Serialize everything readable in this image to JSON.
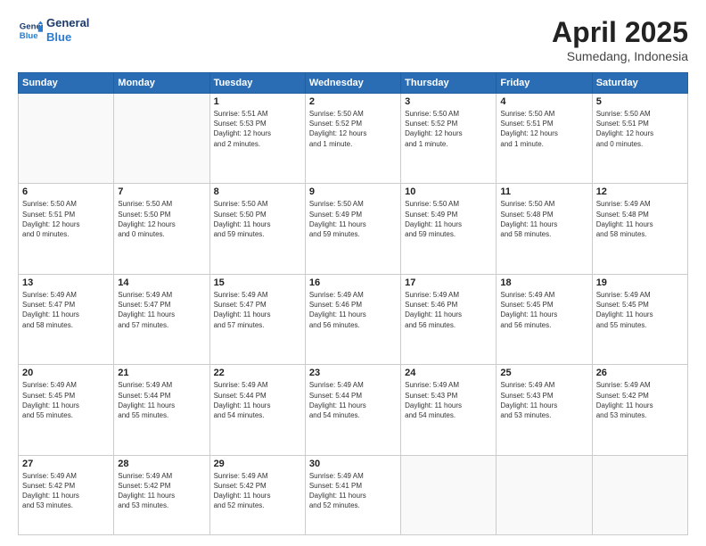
{
  "header": {
    "logo_line1": "General",
    "logo_line2": "Blue",
    "title": "April 2025",
    "subtitle": "Sumedang, Indonesia"
  },
  "weekdays": [
    "Sunday",
    "Monday",
    "Tuesday",
    "Wednesday",
    "Thursday",
    "Friday",
    "Saturday"
  ],
  "weeks": [
    [
      {
        "day": "",
        "info": ""
      },
      {
        "day": "",
        "info": ""
      },
      {
        "day": "1",
        "info": "Sunrise: 5:51 AM\nSunset: 5:53 PM\nDaylight: 12 hours\nand 2 minutes."
      },
      {
        "day": "2",
        "info": "Sunrise: 5:50 AM\nSunset: 5:52 PM\nDaylight: 12 hours\nand 1 minute."
      },
      {
        "day": "3",
        "info": "Sunrise: 5:50 AM\nSunset: 5:52 PM\nDaylight: 12 hours\nand 1 minute."
      },
      {
        "day": "4",
        "info": "Sunrise: 5:50 AM\nSunset: 5:51 PM\nDaylight: 12 hours\nand 1 minute."
      },
      {
        "day": "5",
        "info": "Sunrise: 5:50 AM\nSunset: 5:51 PM\nDaylight: 12 hours\nand 0 minutes."
      }
    ],
    [
      {
        "day": "6",
        "info": "Sunrise: 5:50 AM\nSunset: 5:51 PM\nDaylight: 12 hours\nand 0 minutes."
      },
      {
        "day": "7",
        "info": "Sunrise: 5:50 AM\nSunset: 5:50 PM\nDaylight: 12 hours\nand 0 minutes."
      },
      {
        "day": "8",
        "info": "Sunrise: 5:50 AM\nSunset: 5:50 PM\nDaylight: 11 hours\nand 59 minutes."
      },
      {
        "day": "9",
        "info": "Sunrise: 5:50 AM\nSunset: 5:49 PM\nDaylight: 11 hours\nand 59 minutes."
      },
      {
        "day": "10",
        "info": "Sunrise: 5:50 AM\nSunset: 5:49 PM\nDaylight: 11 hours\nand 59 minutes."
      },
      {
        "day": "11",
        "info": "Sunrise: 5:50 AM\nSunset: 5:48 PM\nDaylight: 11 hours\nand 58 minutes."
      },
      {
        "day": "12",
        "info": "Sunrise: 5:49 AM\nSunset: 5:48 PM\nDaylight: 11 hours\nand 58 minutes."
      }
    ],
    [
      {
        "day": "13",
        "info": "Sunrise: 5:49 AM\nSunset: 5:47 PM\nDaylight: 11 hours\nand 58 minutes."
      },
      {
        "day": "14",
        "info": "Sunrise: 5:49 AM\nSunset: 5:47 PM\nDaylight: 11 hours\nand 57 minutes."
      },
      {
        "day": "15",
        "info": "Sunrise: 5:49 AM\nSunset: 5:47 PM\nDaylight: 11 hours\nand 57 minutes."
      },
      {
        "day": "16",
        "info": "Sunrise: 5:49 AM\nSunset: 5:46 PM\nDaylight: 11 hours\nand 56 minutes."
      },
      {
        "day": "17",
        "info": "Sunrise: 5:49 AM\nSunset: 5:46 PM\nDaylight: 11 hours\nand 56 minutes."
      },
      {
        "day": "18",
        "info": "Sunrise: 5:49 AM\nSunset: 5:45 PM\nDaylight: 11 hours\nand 56 minutes."
      },
      {
        "day": "19",
        "info": "Sunrise: 5:49 AM\nSunset: 5:45 PM\nDaylight: 11 hours\nand 55 minutes."
      }
    ],
    [
      {
        "day": "20",
        "info": "Sunrise: 5:49 AM\nSunset: 5:45 PM\nDaylight: 11 hours\nand 55 minutes."
      },
      {
        "day": "21",
        "info": "Sunrise: 5:49 AM\nSunset: 5:44 PM\nDaylight: 11 hours\nand 55 minutes."
      },
      {
        "day": "22",
        "info": "Sunrise: 5:49 AM\nSunset: 5:44 PM\nDaylight: 11 hours\nand 54 minutes."
      },
      {
        "day": "23",
        "info": "Sunrise: 5:49 AM\nSunset: 5:44 PM\nDaylight: 11 hours\nand 54 minutes."
      },
      {
        "day": "24",
        "info": "Sunrise: 5:49 AM\nSunset: 5:43 PM\nDaylight: 11 hours\nand 54 minutes."
      },
      {
        "day": "25",
        "info": "Sunrise: 5:49 AM\nSunset: 5:43 PM\nDaylight: 11 hours\nand 53 minutes."
      },
      {
        "day": "26",
        "info": "Sunrise: 5:49 AM\nSunset: 5:42 PM\nDaylight: 11 hours\nand 53 minutes."
      }
    ],
    [
      {
        "day": "27",
        "info": "Sunrise: 5:49 AM\nSunset: 5:42 PM\nDaylight: 11 hours\nand 53 minutes."
      },
      {
        "day": "28",
        "info": "Sunrise: 5:49 AM\nSunset: 5:42 PM\nDaylight: 11 hours\nand 53 minutes."
      },
      {
        "day": "29",
        "info": "Sunrise: 5:49 AM\nSunset: 5:42 PM\nDaylight: 11 hours\nand 52 minutes."
      },
      {
        "day": "30",
        "info": "Sunrise: 5:49 AM\nSunset: 5:41 PM\nDaylight: 11 hours\nand 52 minutes."
      },
      {
        "day": "",
        "info": ""
      },
      {
        "day": "",
        "info": ""
      },
      {
        "day": "",
        "info": ""
      }
    ]
  ]
}
